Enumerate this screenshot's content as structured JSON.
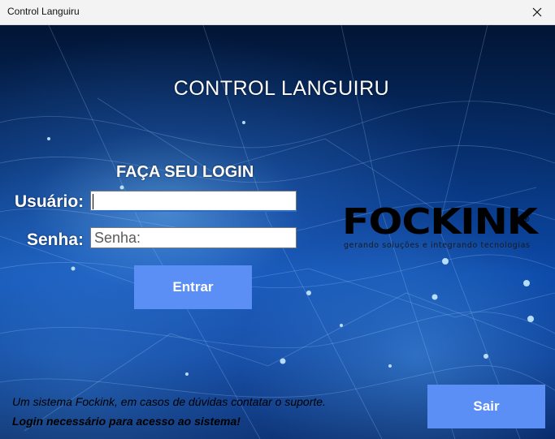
{
  "window": {
    "title": "Control Languiru",
    "close_icon": "close-icon"
  },
  "main": {
    "heading": "CONTROL LANGUIRU",
    "login_title": "FAÇA SEU LOGIN",
    "user_label": "Usuário:",
    "user_value": "",
    "password_label": "Senha:",
    "password_placeholder": "Senha:",
    "enter_button": "Entrar",
    "exit_button": "Sair",
    "button_color": "#5b8ff5"
  },
  "logo": {
    "name": "FOCKINK",
    "tagline": "gerando soluções e integrando tecnologias",
    "registered": "®",
    "accent_color": "#d41e2b"
  },
  "footer": {
    "line1": "Um sistema Fockink, em casos de dúvidas contatar o suporte.",
    "line2": "Login necessário para acesso ao sistema!"
  }
}
